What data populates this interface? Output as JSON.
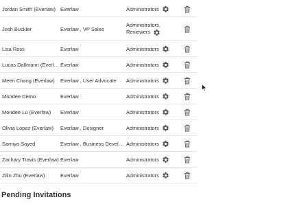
{
  "members": [
    {
      "name": "Jordan Smith (Everlaw)",
      "org": "Everlaw",
      "role": "Administrators"
    },
    {
      "name": "Josh Buckler",
      "org": "Everlaw , VP Sales",
      "role_line1": "Administrators,",
      "role_line2": "Reviewers"
    },
    {
      "name": "Lisa Ross",
      "org": "Everlaw",
      "role": "Administrators"
    },
    {
      "name": "Lucas Dallmann (Everla...",
      "org": "Everlaw",
      "role": "Administrators"
    },
    {
      "name": "Meeri Chang (Everlaw)",
      "org": "Everlaw , User Advocate",
      "role": "Administrators"
    },
    {
      "name": "Mondee Demo",
      "org": "Everlaw",
      "role": "Administrators"
    },
    {
      "name": "Mondee Lu (Everlaw)",
      "org": "Everlaw",
      "role": "Administrators"
    },
    {
      "name": "Olivia Lopez (Everlaw)",
      "org": "Everlaw , Designer",
      "role": "Administrators"
    },
    {
      "name": "Samiya Sayed",
      "org": "Everlaw , Business Develop...",
      "role": "Administrators"
    },
    {
      "name": "Zachary Travis (Everlaw)",
      "org": "Everlaw",
      "role": "Administrators"
    },
    {
      "name": "Zilin Zhu (Everlaw)",
      "org": "Everlaw",
      "role": "Administrators"
    }
  ],
  "sections": {
    "pending_title": "Pending Invitations"
  },
  "icons": {
    "settings": "gear-icon",
    "delete": "trash-icon",
    "pointer": "mouse-cursor-icon"
  },
  "colors": {
    "icon": "#555555",
    "text": "#333333",
    "divider": "#e3e3e3"
  }
}
